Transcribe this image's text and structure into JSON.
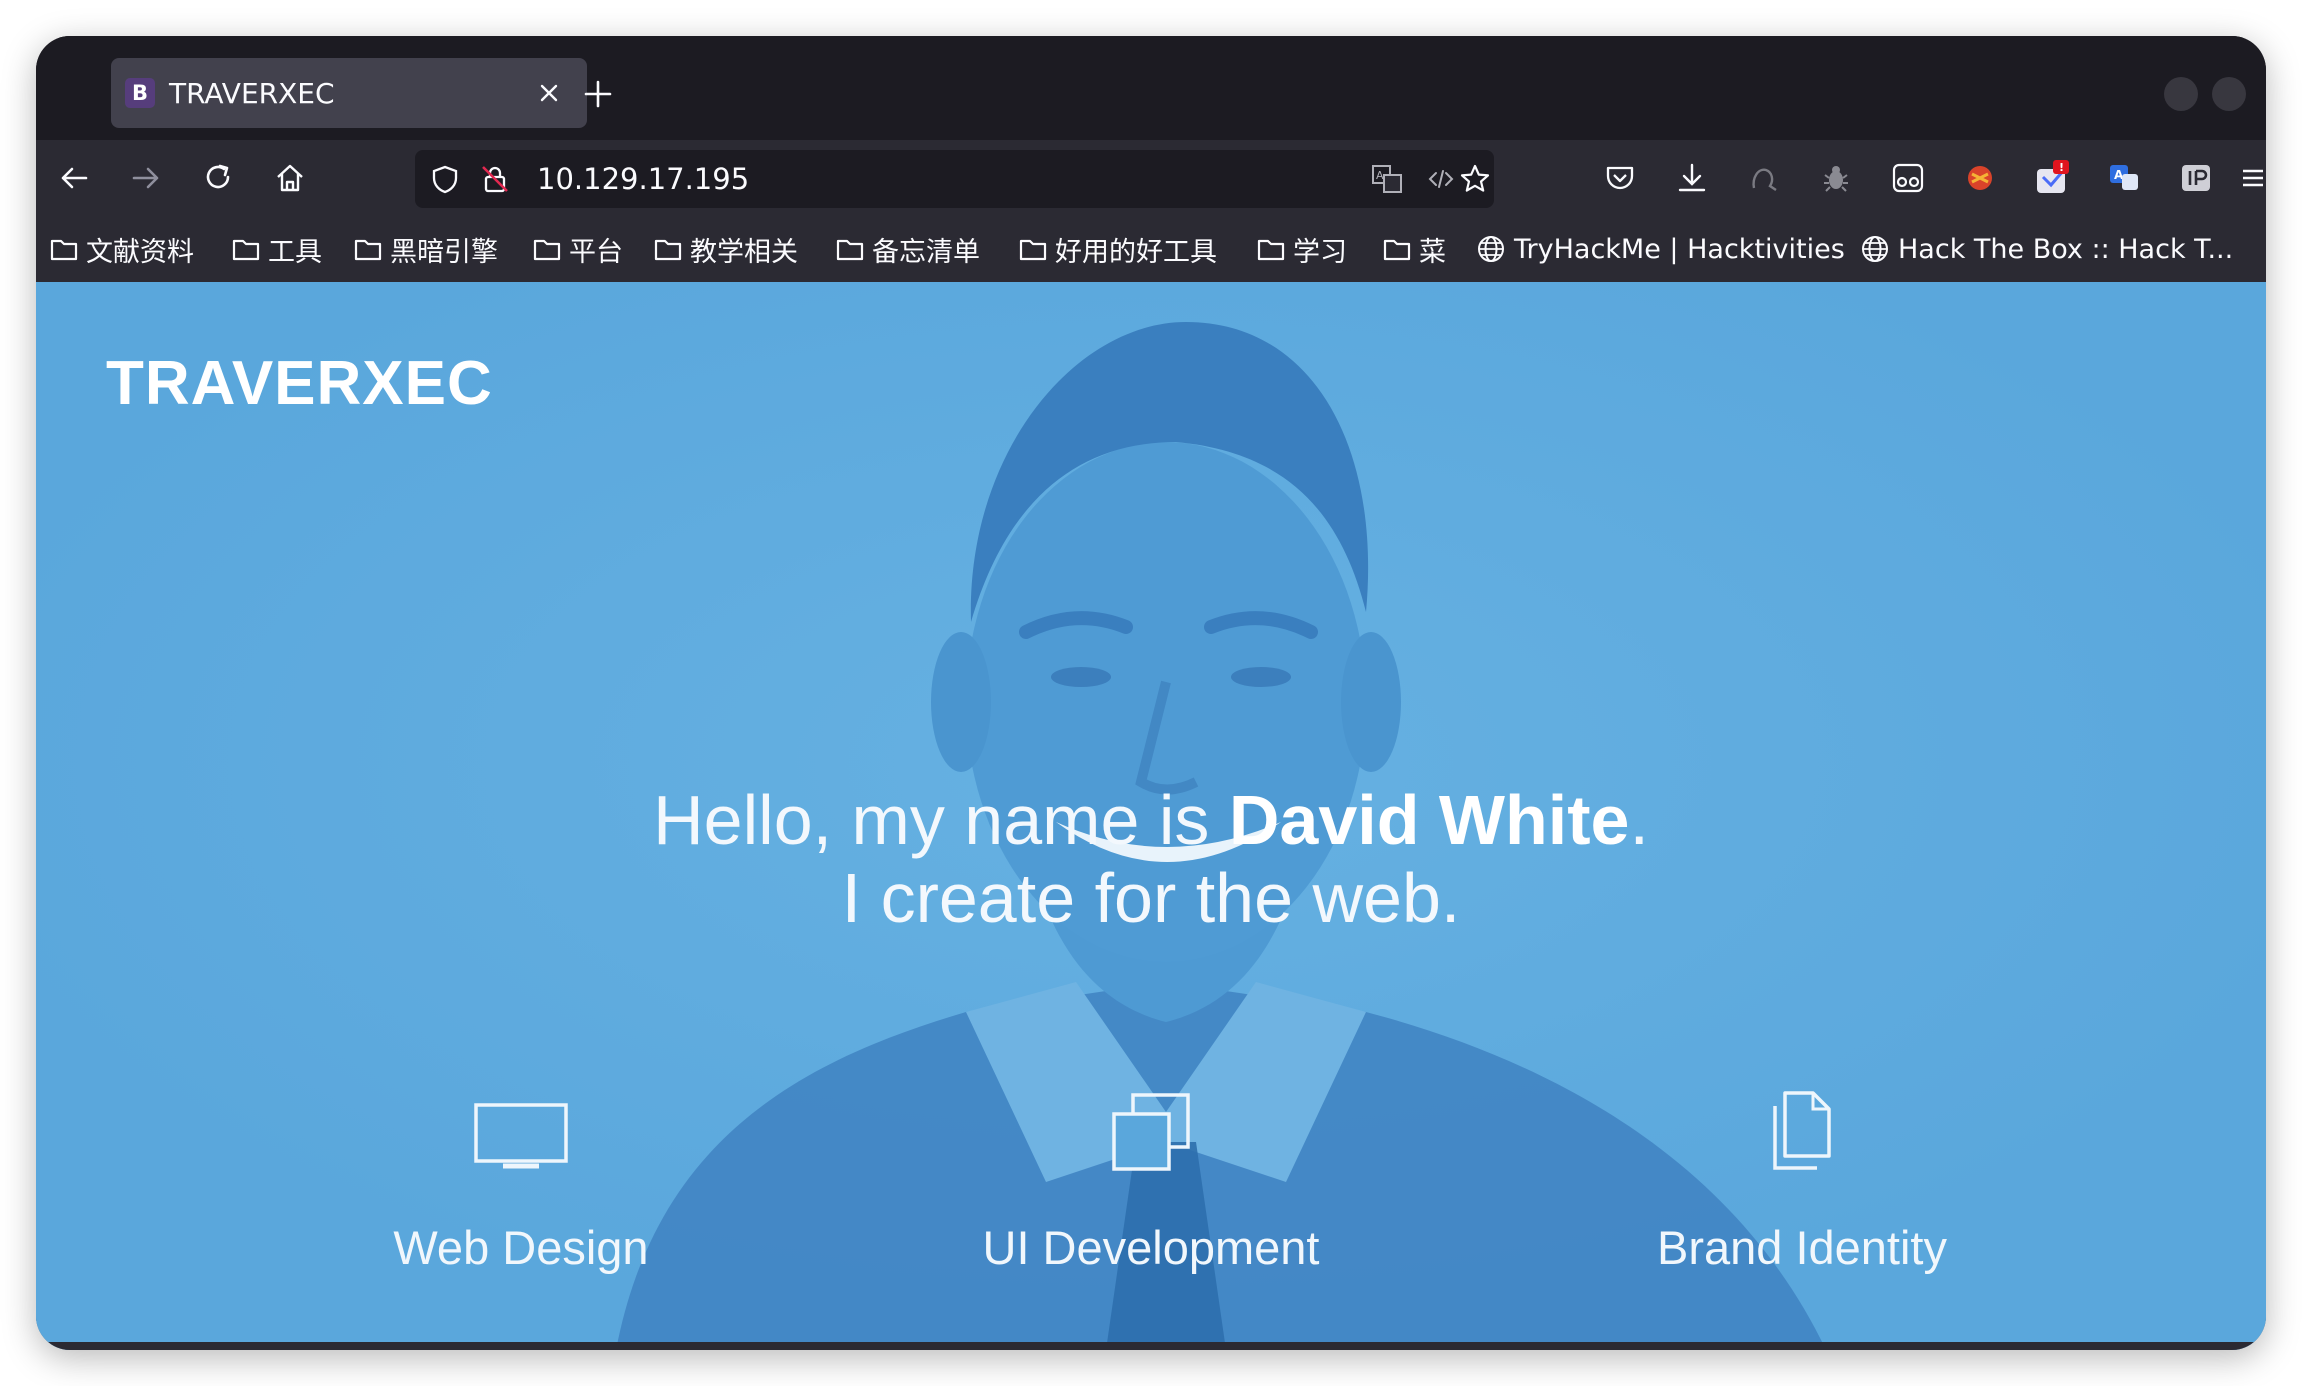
{
  "browser": {
    "tab": {
      "favicon_letter": "B",
      "title": "TRAVERXEC"
    },
    "url": "10.129.17.195",
    "bookmarks": [
      {
        "label": "文献资料",
        "icon": "folder-icon"
      },
      {
        "label": "工具",
        "icon": "folder-icon"
      },
      {
        "label": "黑暗引擎",
        "icon": "folder-icon"
      },
      {
        "label": "平台",
        "icon": "folder-icon"
      },
      {
        "label": "教学相关",
        "icon": "folder-icon"
      },
      {
        "label": "备忘清单",
        "icon": "folder-icon"
      },
      {
        "label": "好用的好工具",
        "icon": "folder-icon"
      },
      {
        "label": "学习",
        "icon": "folder-icon"
      },
      {
        "label": "菜",
        "icon": "folder-icon"
      },
      {
        "label": "TryHackMe | Hacktivities",
        "icon": "globe-icon"
      },
      {
        "label": "Hack The Box :: Hack T...",
        "icon": "globe-icon"
      }
    ]
  },
  "site": {
    "brand": "TRAVERXEC",
    "hero": {
      "intro": "Hello, my name is ",
      "name": "David White",
      "period": ".",
      "tagline": "I create for the web."
    },
    "services": [
      {
        "icon": "monitor-icon",
        "label": "Web Design"
      },
      {
        "icon": "windows-stack-icon",
        "label": "UI Development"
      },
      {
        "icon": "documents-icon",
        "label": "Brand Identity"
      }
    ]
  },
  "colors": {
    "page_background": "#5aa7dc",
    "toolbar": "#2b2a33",
    "tabstrip": "#1c1b22"
  }
}
